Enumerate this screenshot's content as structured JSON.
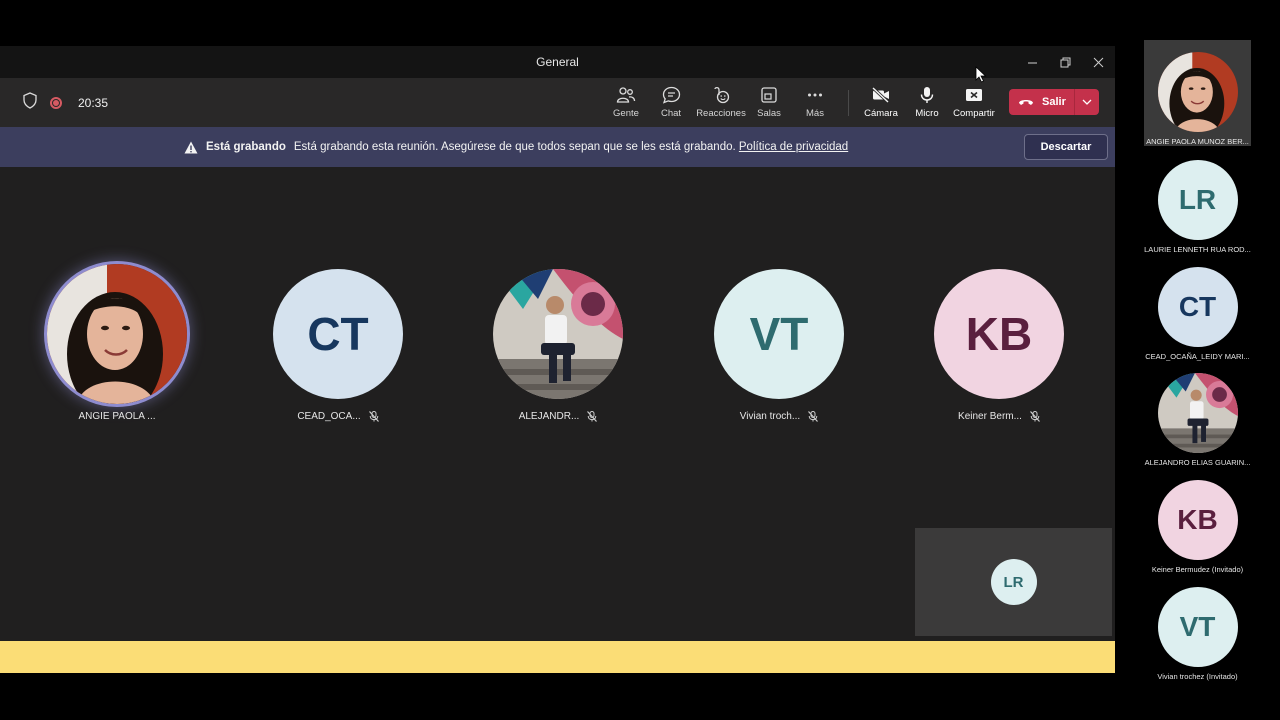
{
  "window": {
    "title": "General"
  },
  "toolbar": {
    "timer": "20:35",
    "buttons": {
      "people": "Gente",
      "chat": "Chat",
      "reactions": "Reacciones",
      "rooms": "Salas",
      "more": "Más",
      "camera": "Cámara",
      "mic": "Micro",
      "share": "Compartir"
    },
    "leave_label": "Salir"
  },
  "banner": {
    "title": "Está grabando",
    "message": "Está grabando esta reunión. Asegúrese de que todos sepan que se les está grabando.",
    "link": "Política de privacidad",
    "dismiss": "Descartar"
  },
  "participants": [
    {
      "name": "ANGIE PAOLA ...",
      "initials": "",
      "photo": true,
      "speaking": true,
      "muted": false
    },
    {
      "name": "CEAD_OCA...",
      "initials": "CT",
      "bg": "#d5e2ee",
      "fg": "#17375e",
      "muted": true
    },
    {
      "name": "ALEJANDR...",
      "initials": "",
      "photo": true,
      "muted": true
    },
    {
      "name": "Vivian troch...",
      "initials": "VT",
      "bg": "#ddeff0",
      "fg": "#2e6b6f",
      "muted": true
    },
    {
      "name": "Keiner Berm...",
      "initials": "KB",
      "bg": "#f1d4e1",
      "fg": "#5a1f3e",
      "muted": true
    }
  ],
  "self_view": {
    "initials": "LR"
  },
  "sidebar": [
    {
      "name": "ANGIE PAOLA MUNOZ BER...",
      "initials": "",
      "photo": true
    },
    {
      "name": "LAURIE LENNETH RUA ROD...",
      "initials": "LR",
      "bg": "#ddeff0",
      "fg": "#2e6b6f"
    },
    {
      "name": "CEAD_OCAÑA_LEIDY MARI...",
      "initials": "CT",
      "bg": "#d5e2ee",
      "fg": "#17375e"
    },
    {
      "name": "ALEJANDRO ELIAS GUARIN...",
      "initials": "",
      "photo": true
    },
    {
      "name": "Keiner Bermudez (Invitado)",
      "initials": "KB",
      "bg": "#f1d4e1",
      "fg": "#5a1f3e"
    },
    {
      "name": "Vivian trochez (Invitado)",
      "initials": "VT",
      "bg": "#ddeff0",
      "fg": "#2e6b6f"
    }
  ]
}
